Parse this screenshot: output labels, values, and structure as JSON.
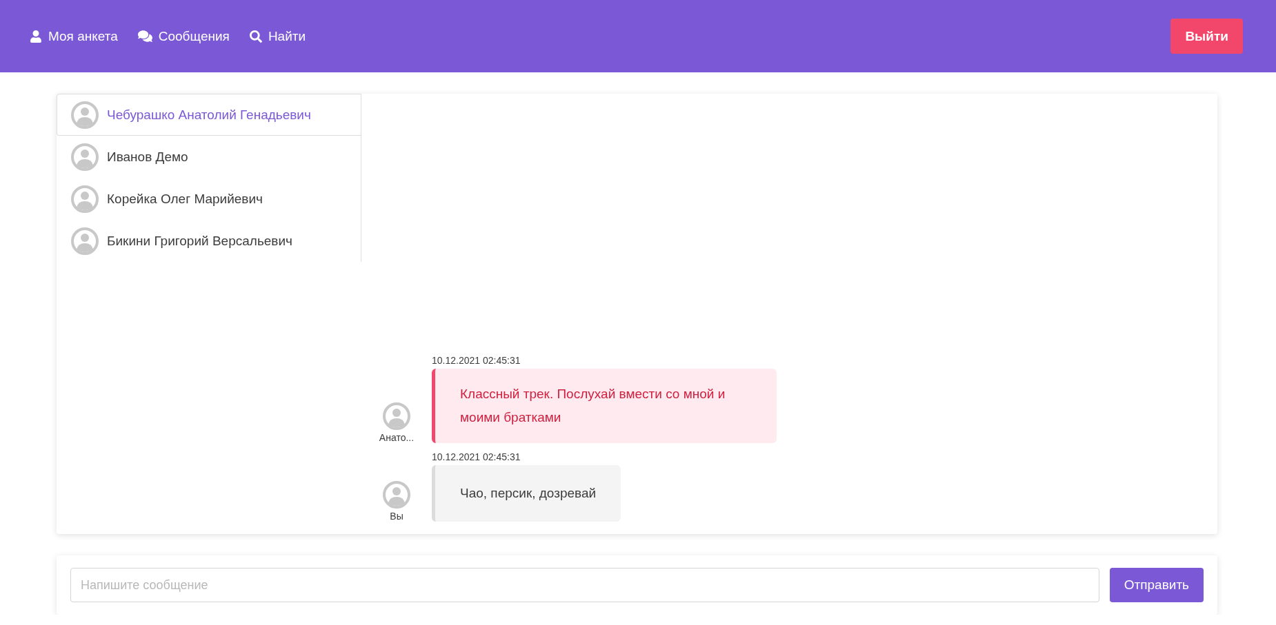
{
  "nav": {
    "items": [
      {
        "kind": "profile",
        "label": "Моя анкета"
      },
      {
        "kind": "messages",
        "label": "Сообщения"
      },
      {
        "kind": "search",
        "label": "Найти"
      }
    ],
    "logout": "Выйти"
  },
  "contacts": [
    {
      "name": "Чебурашко Анатолий Генадьевич",
      "selected": true
    },
    {
      "name": "Иванов Демо",
      "selected": false
    },
    {
      "name": "Корейка Олег Марийевич",
      "selected": false
    },
    {
      "name": "Бикини Григорий Версальевич",
      "selected": false
    }
  ],
  "messages": [
    {
      "kind": "incoming",
      "author": "Анато...",
      "time": "10.12.2021 02:45:31",
      "text": "Классный трек. Послухай вмести со мной и моими братками"
    },
    {
      "kind": "outgoing",
      "author": "Вы",
      "time": "10.12.2021 02:45:31",
      "text": "Чао, персик, дозревай"
    }
  ],
  "composer": {
    "placeholder": "Напишите сообщение",
    "send": "Отправить"
  }
}
